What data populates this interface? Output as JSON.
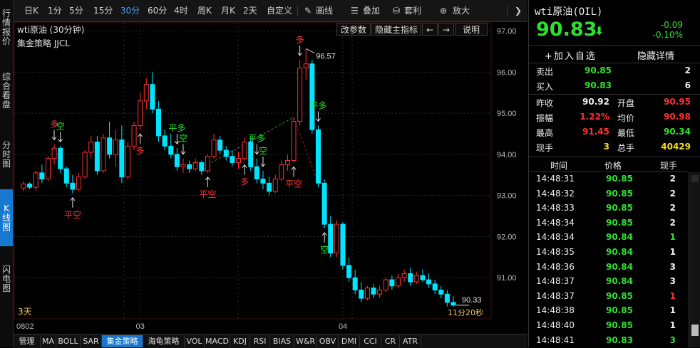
{
  "leftnav": [
    {
      "label": "行情报价",
      "active": false
    },
    {
      "label": "综合看盘",
      "active": false
    },
    {
      "label": "分时图",
      "active": false
    },
    {
      "label": "K线图",
      "active": true
    },
    {
      "label": "闪电图",
      "active": false
    }
  ],
  "toolbar": {
    "periods": [
      "日K",
      "1分",
      "5分",
      "15分",
      "30分",
      "60分",
      "4时",
      "周K",
      "月K",
      "2天",
      "自定义"
    ],
    "active_period": "30分",
    "draw_label": "画线",
    "overlay_label": "叠加",
    "arb_label": "套利",
    "zoom_label": "放大",
    "expand_glyph": "❯"
  },
  "chart": {
    "title": "wti原油 (30分钟)",
    "strategy": "集金策略 JJCL",
    "buttons": {
      "params": "改参数",
      "hide_main": "隐藏主指标",
      "prev": "←",
      "next": "→",
      "help": "说明"
    },
    "max_label": "96.57",
    "last_label": "90.33",
    "countdown": "11分20秒",
    "days": "3天"
  },
  "chart_data": {
    "type": "candlestick",
    "ylim": [
      90.0,
      97.2
    ],
    "y_ticks": [
      "97.00",
      "96.00",
      "95.00",
      "94.00",
      "93.00",
      "92.00",
      "91.00"
    ],
    "x_labels": [
      "0802",
      "03",
      "04"
    ],
    "x_label_index": [
      0,
      19,
      52
    ],
    "signals": [
      {
        "i": 5,
        "text": "多",
        "dir": "down"
      },
      {
        "i": 6,
        "text": "空",
        "dir": "down"
      },
      {
        "i": 8,
        "text": "平空",
        "dir": "up"
      },
      {
        "i": 19,
        "text": "多",
        "dir": "up"
      },
      {
        "i": 25,
        "text": "平多",
        "dir": "down"
      },
      {
        "i": 26,
        "text": "空",
        "dir": "down"
      },
      {
        "i": 30,
        "text": "平空",
        "dir": "up"
      },
      {
        "i": 36,
        "text": "多",
        "dir": "up"
      },
      {
        "i": 38,
        "text": "平多",
        "dir": "down"
      },
      {
        "i": 39,
        "text": "空",
        "dir": "down"
      },
      {
        "i": 44,
        "text": "平空",
        "dir": "up"
      },
      {
        "i": 45,
        "text": "多",
        "dir": "down"
      },
      {
        "i": 48,
        "text": "平多",
        "dir": "down"
      },
      {
        "i": 49,
        "text": "空",
        "dir": "up"
      }
    ],
    "candles": [
      {
        "o": 93.18,
        "h": 93.35,
        "l": 93.1,
        "c": 93.28
      },
      {
        "o": 93.28,
        "h": 93.32,
        "l": 93.15,
        "c": 93.2
      },
      {
        "o": 93.2,
        "h": 93.6,
        "l": 93.12,
        "c": 93.55
      },
      {
        "o": 93.55,
        "h": 93.75,
        "l": 93.3,
        "c": 93.4
      },
      {
        "o": 93.4,
        "h": 93.95,
        "l": 93.35,
        "c": 93.9
      },
      {
        "o": 93.9,
        "h": 94.25,
        "l": 93.75,
        "c": 94.15
      },
      {
        "o": 94.15,
        "h": 94.2,
        "l": 93.55,
        "c": 93.65
      },
      {
        "o": 93.65,
        "h": 93.7,
        "l": 93.2,
        "c": 93.3
      },
      {
        "o": 93.3,
        "h": 93.5,
        "l": 93.05,
        "c": 93.15
      },
      {
        "o": 93.15,
        "h": 93.55,
        "l": 93.1,
        "c": 93.45
      },
      {
        "o": 93.45,
        "h": 94.1,
        "l": 93.4,
        "c": 94.05
      },
      {
        "o": 94.05,
        "h": 94.45,
        "l": 93.9,
        "c": 94.3
      },
      {
        "o": 94.3,
        "h": 94.45,
        "l": 93.5,
        "c": 93.6
      },
      {
        "o": 93.6,
        "h": 94.5,
        "l": 93.55,
        "c": 94.4
      },
      {
        "o": 94.4,
        "h": 94.8,
        "l": 93.9,
        "c": 94.0
      },
      {
        "o": 94.0,
        "h": 94.6,
        "l": 93.7,
        "c": 94.35
      },
      {
        "o": 94.35,
        "h": 94.7,
        "l": 93.3,
        "c": 93.45
      },
      {
        "o": 93.45,
        "h": 94.3,
        "l": 93.4,
        "c": 94.2
      },
      {
        "o": 94.2,
        "h": 94.8,
        "l": 94.1,
        "c": 94.7
      },
      {
        "o": 94.7,
        "h": 95.5,
        "l": 94.6,
        "c": 95.3
      },
      {
        "o": 95.3,
        "h": 95.85,
        "l": 95.1,
        "c": 95.7
      },
      {
        "o": 95.7,
        "h": 96.0,
        "l": 95.0,
        "c": 95.1
      },
      {
        "o": 95.1,
        "h": 95.3,
        "l": 94.3,
        "c": 94.45
      },
      {
        "o": 94.45,
        "h": 94.6,
        "l": 94.1,
        "c": 94.2
      },
      {
        "o": 94.2,
        "h": 94.5,
        "l": 93.9,
        "c": 94.0
      },
      {
        "o": 94.0,
        "h": 94.15,
        "l": 93.6,
        "c": 93.7
      },
      {
        "o": 93.7,
        "h": 93.9,
        "l": 93.55,
        "c": 93.75
      },
      {
        "o": 93.75,
        "h": 93.85,
        "l": 93.55,
        "c": 93.65
      },
      {
        "o": 93.65,
        "h": 93.9,
        "l": 93.6,
        "c": 93.8
      },
      {
        "o": 93.8,
        "h": 93.85,
        "l": 93.5,
        "c": 93.6
      },
      {
        "o": 93.6,
        "h": 94.0,
        "l": 93.55,
        "c": 93.95
      },
      {
        "o": 93.95,
        "h": 94.5,
        "l": 93.9,
        "c": 94.35
      },
      {
        "o": 94.35,
        "h": 94.45,
        "l": 94.0,
        "c": 94.1
      },
      {
        "o": 94.1,
        "h": 94.2,
        "l": 93.85,
        "c": 93.95
      },
      {
        "o": 93.95,
        "h": 94.1,
        "l": 93.7,
        "c": 93.8
      },
      {
        "o": 93.8,
        "h": 94.05,
        "l": 93.65,
        "c": 93.9
      },
      {
        "o": 93.9,
        "h": 94.4,
        "l": 93.85,
        "c": 94.3
      },
      {
        "o": 94.3,
        "h": 94.45,
        "l": 93.6,
        "c": 93.7
      },
      {
        "o": 93.7,
        "h": 93.9,
        "l": 93.3,
        "c": 93.4
      },
      {
        "o": 93.4,
        "h": 93.6,
        "l": 93.15,
        "c": 93.3
      },
      {
        "o": 93.3,
        "h": 93.45,
        "l": 93.0,
        "c": 93.1
      },
      {
        "o": 93.1,
        "h": 93.5,
        "l": 93.05,
        "c": 93.4
      },
      {
        "o": 93.4,
        "h": 93.85,
        "l": 93.35,
        "c": 93.75
      },
      {
        "o": 93.75,
        "h": 94.0,
        "l": 93.6,
        "c": 93.85
      },
      {
        "o": 93.85,
        "h": 94.9,
        "l": 93.8,
        "c": 94.8
      },
      {
        "o": 94.8,
        "h": 96.3,
        "l": 94.7,
        "c": 96.1
      },
      {
        "o": 96.1,
        "h": 96.57,
        "l": 95.8,
        "c": 96.2
      },
      {
        "o": 96.2,
        "h": 96.3,
        "l": 94.5,
        "c": 94.6
      },
      {
        "o": 94.6,
        "h": 94.7,
        "l": 93.2,
        "c": 93.3
      },
      {
        "o": 93.3,
        "h": 93.4,
        "l": 92.2,
        "c": 92.3
      },
      {
        "o": 92.3,
        "h": 92.5,
        "l": 91.5,
        "c": 91.6
      },
      {
        "o": 91.6,
        "h": 92.4,
        "l": 91.5,
        "c": 92.3
      },
      {
        "o": 92.3,
        "h": 92.35,
        "l": 91.2,
        "c": 91.3
      },
      {
        "o": 91.3,
        "h": 91.5,
        "l": 90.9,
        "c": 91.0
      },
      {
        "o": 91.0,
        "h": 91.2,
        "l": 90.6,
        "c": 90.7
      },
      {
        "o": 90.7,
        "h": 90.9,
        "l": 90.4,
        "c": 90.5
      },
      {
        "o": 90.5,
        "h": 90.8,
        "l": 90.45,
        "c": 90.75
      },
      {
        "o": 90.75,
        "h": 90.85,
        "l": 90.5,
        "c": 90.6
      },
      {
        "o": 90.6,
        "h": 90.8,
        "l": 90.5,
        "c": 90.7
      },
      {
        "o": 90.7,
        "h": 91.0,
        "l": 90.65,
        "c": 90.95
      },
      {
        "o": 90.95,
        "h": 91.05,
        "l": 90.7,
        "c": 90.8
      },
      {
        "o": 90.8,
        "h": 91.1,
        "l": 90.75,
        "c": 91.0
      },
      {
        "o": 91.0,
        "h": 91.2,
        "l": 90.9,
        "c": 91.1
      },
      {
        "o": 91.1,
        "h": 91.25,
        "l": 90.8,
        "c": 90.9
      },
      {
        "o": 90.9,
        "h": 91.15,
        "l": 90.85,
        "c": 91.05
      },
      {
        "o": 91.05,
        "h": 91.2,
        "l": 90.9,
        "c": 90.95
      },
      {
        "o": 90.95,
        "h": 91.1,
        "l": 90.75,
        "c": 90.85
      },
      {
        "o": 90.85,
        "h": 90.95,
        "l": 90.6,
        "c": 90.7
      },
      {
        "o": 90.7,
        "h": 90.8,
        "l": 90.5,
        "c": 90.6
      },
      {
        "o": 90.6,
        "h": 90.7,
        "l": 90.3,
        "c": 90.4
      },
      {
        "o": 90.4,
        "h": 90.55,
        "l": 90.3,
        "c": 90.33
      }
    ]
  },
  "bottom_tabs": [
    {
      "label": "管理",
      "active": false
    },
    {
      "label": "MA",
      "active": false
    },
    {
      "label": "BOLL",
      "active": false
    },
    {
      "label": "SAR",
      "active": false
    },
    {
      "label": "集金策略",
      "active": true
    },
    {
      "label": "海龟策略",
      "active": false
    },
    {
      "label": "VOL",
      "active": false
    },
    {
      "label": "MACD",
      "active": false
    },
    {
      "label": "KDJ",
      "active": false
    },
    {
      "label": "RSI",
      "active": false
    },
    {
      "label": "BIAS",
      "active": false
    },
    {
      "label": "W&R",
      "active": false
    },
    {
      "label": "OBV",
      "active": false
    },
    {
      "label": "DMI",
      "active": false
    },
    {
      "label": "CCI",
      "active": false
    },
    {
      "label": "CR",
      "active": false
    },
    {
      "label": "ATR",
      "active": false
    }
  ],
  "quote": {
    "name": "wti原油(OIL)",
    "price": "90.83",
    "arrow": "⬇",
    "change": "-0.09",
    "change_pct": "-0.10%",
    "add_watch": "+加入自选",
    "hide_detail": "隐藏详情",
    "sell_label": "卖出",
    "sell_price": "90.85",
    "sell_vol": "2",
    "buy_label": "买入",
    "buy_price": "90.83",
    "buy_vol": "6",
    "stats": [
      {
        "l1": "昨收",
        "v1": "90.92",
        "c1": "white",
        "l2": "开盘",
        "v2": "90.95",
        "c2": "red"
      },
      {
        "l1": "振幅",
        "v1": "1.22%",
        "c1": "red",
        "l2": "均价",
        "v2": "90.98",
        "c2": "red"
      },
      {
        "l1": "最高",
        "v1": "91.45",
        "c1": "red",
        "l2": "最低",
        "v2": "90.34",
        "c2": "green"
      },
      {
        "l1": "现手",
        "v1": "3",
        "c1": "yellow",
        "l2": "总手",
        "v2": "40429",
        "c2": "yellow"
      }
    ],
    "trade_headers": [
      "时间",
      "价格",
      "现手"
    ],
    "trades": [
      {
        "time": "14:48:31",
        "price": "90.85",
        "vol": "2",
        "vc": "white"
      },
      {
        "time": "14:48:32",
        "price": "90.85",
        "vol": "2",
        "vc": "white"
      },
      {
        "time": "14:48:33",
        "price": "90.85",
        "vol": "2",
        "vc": "white"
      },
      {
        "time": "14:48:34",
        "price": "90.85",
        "vol": "2",
        "vc": "white"
      },
      {
        "time": "14:48:34",
        "price": "90.84",
        "vol": "1",
        "vc": "green"
      },
      {
        "time": "14:48:35",
        "price": "90.84",
        "vol": "1",
        "vc": "white"
      },
      {
        "time": "14:48:36",
        "price": "90.84",
        "vol": "3",
        "vc": "white"
      },
      {
        "time": "14:48:37",
        "price": "90.84",
        "vol": "3",
        "vc": "white"
      },
      {
        "time": "14:48:37",
        "price": "90.85",
        "vol": "1",
        "vc": "red"
      },
      {
        "time": "14:48:38",
        "price": "90.85",
        "vol": "1",
        "vc": "white"
      },
      {
        "time": "14:48:40",
        "price": "90.85",
        "vol": "1",
        "vc": "white"
      },
      {
        "time": "14:48:41",
        "price": "90.83",
        "vol": "3",
        "vc": "green"
      }
    ]
  },
  "colors": {
    "up": "#ff3030",
    "down": "#00e5ff",
    "grid": "#2b2b2b",
    "grid_solid": "#3a1010",
    "accent": "#1778d0"
  }
}
